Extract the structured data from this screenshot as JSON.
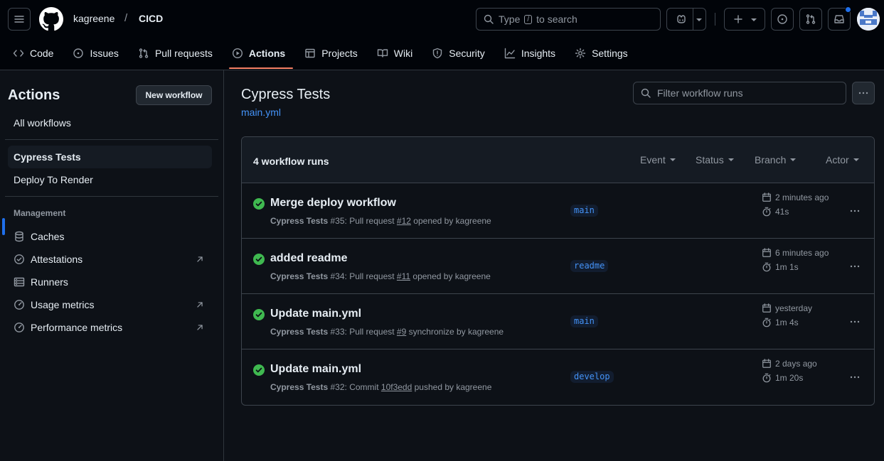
{
  "header": {
    "owner": "kagreene",
    "separator": "/",
    "repo": "CICD",
    "search": {
      "prefix": "Type",
      "key": "/",
      "suffix": "to search"
    }
  },
  "tabs": [
    {
      "label": "Code",
      "icon": "code-icon"
    },
    {
      "label": "Issues",
      "icon": "issue-icon"
    },
    {
      "label": "Pull requests",
      "icon": "pull-request-icon"
    },
    {
      "label": "Actions",
      "icon": "play-icon",
      "active": true
    },
    {
      "label": "Projects",
      "icon": "table-icon"
    },
    {
      "label": "Wiki",
      "icon": "book-icon"
    },
    {
      "label": "Security",
      "icon": "shield-icon"
    },
    {
      "label": "Insights",
      "icon": "graph-icon"
    },
    {
      "label": "Settings",
      "icon": "gear-icon"
    }
  ],
  "sidebar": {
    "title": "Actions",
    "new_workflow": "New workflow",
    "all_workflows": "All workflows",
    "workflows": [
      "Cypress Tests",
      "Deploy To Render"
    ],
    "management_heading": "Management",
    "management": [
      {
        "label": "Caches",
        "icon": "database-icon"
      },
      {
        "label": "Attestations",
        "icon": "verified-icon"
      },
      {
        "label": "Runners",
        "icon": "server-icon"
      },
      {
        "label": "Usage metrics",
        "icon": "meter-icon"
      },
      {
        "label": "Performance metrics",
        "icon": "meter-icon"
      }
    ]
  },
  "main": {
    "title": "Cypress Tests",
    "file": "main.yml",
    "filter_placeholder": "Filter workflow runs",
    "runs_count": "4 workflow runs",
    "filters": [
      "Event",
      "Status",
      "Branch",
      "Actor"
    ],
    "runs": [
      {
        "title": "Merge deploy workflow",
        "workflow": "Cypress Tests",
        "number": "#35",
        "trigger": "Pull request",
        "ref": "#12",
        "action": "opened by kagreene",
        "branch": "main",
        "when": "2 minutes ago",
        "duration": "41s",
        "status": "success"
      },
      {
        "title": "added readme",
        "workflow": "Cypress Tests",
        "number": "#34",
        "trigger": "Pull request",
        "ref": "#11",
        "action": "opened by kagreene",
        "branch": "readme",
        "when": "6 minutes ago",
        "duration": "1m 1s",
        "status": "success"
      },
      {
        "title": "Update main.yml",
        "workflow": "Cypress Tests",
        "number": "#33",
        "trigger": "Pull request",
        "ref": "#9",
        "action": "synchronize by kagreene",
        "branch": "main",
        "when": "yesterday",
        "duration": "1m 4s",
        "status": "success"
      },
      {
        "title": "Update main.yml",
        "workflow": "Cypress Tests",
        "number": "#32",
        "trigger": "Commit",
        "ref": "10f3edd",
        "action": "pushed by kagreene",
        "branch": "develop",
        "when": "2 days ago",
        "duration": "1m 20s",
        "status": "success"
      }
    ]
  },
  "colors": {
    "background": "#0d1117",
    "header": "#010409",
    "accent_link": "#4493f8",
    "success": "#3fb950",
    "active_tab_underline": "#f78166"
  }
}
